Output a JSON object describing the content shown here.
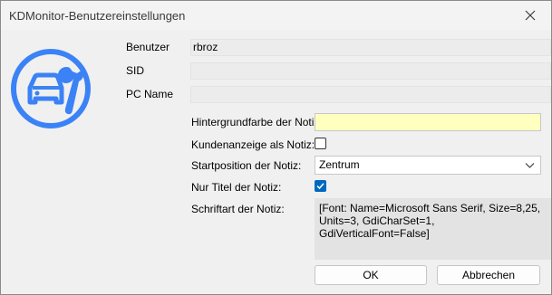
{
  "window": {
    "title": "KDMonitor-Benutzereinstellungen",
    "close_icon": "close-icon"
  },
  "logo": {
    "icon": "car-wrench-logo",
    "color": "#3b82f6"
  },
  "user_info": {
    "user_label": "Benutzer",
    "user_value": "rbroz",
    "sid_label": "SID",
    "sid_value": "",
    "pc_label": "PC Name",
    "pc_value": ""
  },
  "settings": {
    "bg_color_label": "Hintergrundfarbe der Notiz:",
    "bg_color_value": "#ffffc0",
    "customer_display_label": "Kundenanzeige als Notiz:",
    "customer_display_checked": false,
    "start_position_label": "Startposition der Notiz:",
    "start_position_value": "Zentrum",
    "title_only_label": "Nur Titel der Notiz:",
    "title_only_checked": true,
    "font_label": "Schriftart der Notiz:",
    "font_value": "[Font: Name=Microsoft Sans Serif, Size=8,25, Units=3, GdiCharSet=1, GdiVerticalFont=False]"
  },
  "buttons": {
    "ok_label": "OK",
    "cancel_label": "Abbrechen"
  },
  "colors": {
    "accent": "#0067c0",
    "note_bg": "#ffffc0"
  }
}
